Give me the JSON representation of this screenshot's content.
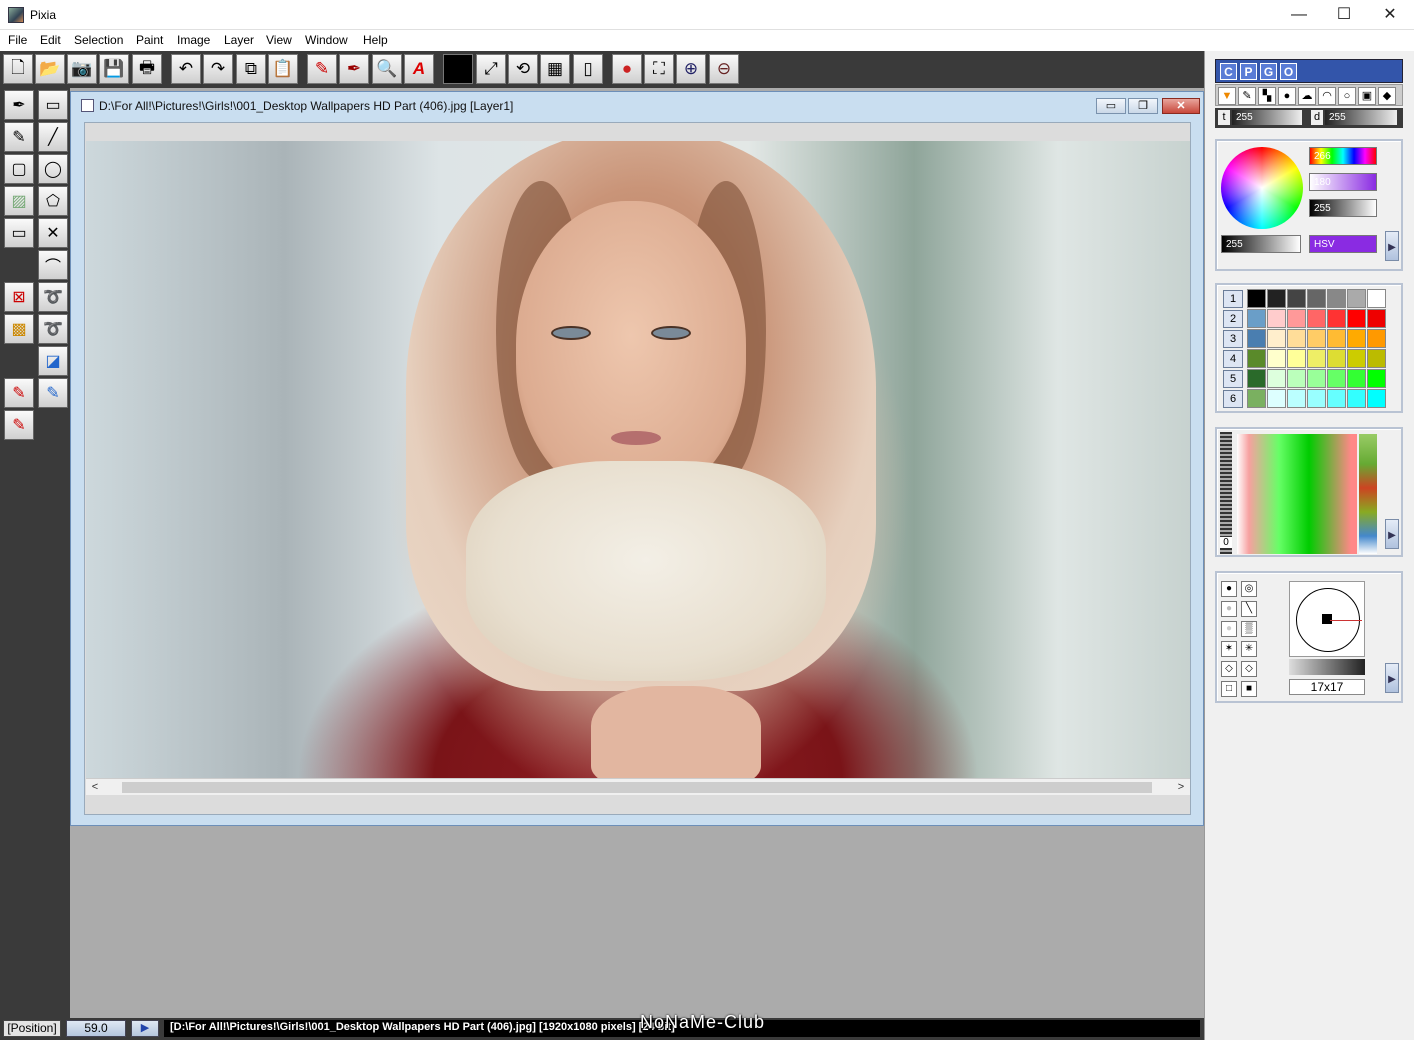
{
  "app": {
    "title": "Pixia"
  },
  "window_controls": {
    "minimize": "—",
    "maximize": "☐",
    "close": "✕"
  },
  "menu": [
    "File",
    "Edit",
    "Selection",
    "Paint",
    "Image",
    "Layer",
    "View",
    "Window",
    "Help"
  ],
  "toolbar": {
    "icons": [
      "new-file-icon",
      "open-folder-icon",
      "camera-icon",
      "save-icon",
      "print-icon",
      "undo-icon",
      "redo-icon",
      "copy-icon",
      "paste-icon",
      "airbrush-icon",
      "pen-icon",
      "magnifier-icon",
      "text-icon",
      "color-swatch-icon",
      "resize-icon",
      "transform-icon",
      "layers-icon",
      "page-icon",
      "ball-icon",
      "filter-icon",
      "zoom-in-icon",
      "zoom-out-icon"
    ],
    "glyphs": [
      "🗋",
      "📂",
      "📷",
      "💾",
      "🖶",
      "↶",
      "↷",
      "⧉",
      "📋",
      "✎",
      "✒",
      "🔍",
      "A",
      "■",
      "⤢",
      "⟲",
      "▦",
      "▯",
      "●",
      "⛶",
      "⊕",
      "⊖"
    ]
  },
  "toolbox": {
    "icons": [
      "pen-tool-icon",
      "rectangle-select-icon",
      "brush-pen-icon",
      "line-tool-icon",
      "rectangle-tool-icon",
      "ellipse-tool-icon",
      "gradient-icon",
      "polygon-tool-icon",
      "frame-tool-icon",
      "cross-tool-icon",
      "curve-tool-icon",
      "deselect-icon",
      "lasso-icon",
      "mosaic-icon",
      "lasso-pen-icon",
      "transform-select-icon",
      "airbrush-red-icon",
      "airbrush-blue-icon",
      "eraser-brush-icon"
    ],
    "glyphs": [
      "✒",
      "▭",
      "✎",
      "╱",
      "▢",
      "◯",
      "▨",
      "⬠",
      "▭",
      "✕",
      "⌒",
      "⊠",
      "➰",
      "▩",
      "➰",
      "◪",
      "✎",
      "✎",
      "✎"
    ]
  },
  "document": {
    "title": "D:\\For All!\\Pictures!\\Girls!\\001_Desktop Wallpapers  HD Part (406).jpg [Layer1]",
    "buttons": {
      "minimize": "▭",
      "restore": "❐",
      "close": "✕"
    },
    "scroll_left": "<",
    "scroll_right": ">"
  },
  "right_panel": {
    "cpgo": [
      "C",
      "P",
      "G",
      "O"
    ],
    "mode_icons": [
      "▼",
      "✎",
      "▚",
      "●",
      "☁",
      "◠",
      "○",
      "▣",
      "◆"
    ],
    "t_label": "t",
    "t_value": "255",
    "d_label": "d",
    "d_value": "255",
    "color": {
      "h": "266",
      "s": "180",
      "v": "255",
      "a": "255",
      "mode": "HSV",
      "accent": "#8a2be2"
    },
    "palette_rows": [
      "1",
      "2",
      "3",
      "4",
      "5",
      "6"
    ],
    "next_arrow": "▶",
    "gradient_label": "0",
    "brush_size": "17x17",
    "brush_icons": [
      "●",
      "◎",
      "●",
      "╲",
      "●",
      "▒",
      "✶",
      "✳",
      "◇",
      "◇",
      "□",
      "■"
    ]
  },
  "statusbar": {
    "position": "[Position]",
    "zoom": "59.0",
    "play": "▶",
    "file": "[D:\\For All!\\Pictures!\\Girls!\\001_Desktop Wallpapers  HD Part (406).jpg] [1920x1080 pixels] [24 bit]"
  },
  "watermark": "NoNaMe-Club"
}
